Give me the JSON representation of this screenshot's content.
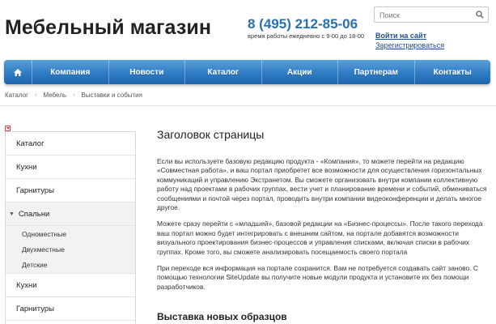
{
  "header": {
    "site_title": "Мебельный магазин",
    "phone": "8 (495) 212-85-06",
    "hours": "время работы ежедневно с 9-00 до 18-00",
    "search_placeholder": "Поиск",
    "login": "Войти на сайт",
    "register": "Зарегистрироваться"
  },
  "nav": {
    "home_icon": "home-icon",
    "items": [
      "Компания",
      "Новости",
      "Каталог",
      "Акции",
      "Партнерам",
      "Контакты"
    ]
  },
  "breadcrumb": [
    "Каталог",
    "Мебель",
    "Выставки и события"
  ],
  "sidebar": {
    "items": [
      {
        "label": "Каталог"
      },
      {
        "label": "Кухни"
      },
      {
        "label": "Гарнитуры"
      },
      {
        "label": "Спальни",
        "expanded": true,
        "children": [
          "Одноместные",
          "Двухместные",
          "Детские"
        ]
      },
      {
        "label": "Кухни"
      },
      {
        "label": "Гарнитуры"
      }
    ]
  },
  "content": {
    "title": "Заголовок страницы",
    "paragraphs": [
      "Если вы используете базовую редакцию продукта - «Компания», то можете перейти на редакцию «Совместная работа», и ваш портал приобретет все возможности для осуществления горизонтальных коммуникаций и управлению Экстранетом. Вы сможете организовать внутри компании коллективную работу над проектами в рабочих группах, вести учет и планирование времени и событий, обмениваться сообщениями и почтой через портал, проводить внутри компании видеоконференции и делать многое другое.",
      "Можете сразу перейти с «младшей», базовой редакции на «Бизнес-процессы». После такого перехода ваш портал можно будет интегрировать с внешним сайтом, на портале добавятся возможности визуального проектирования бизнес-процессов и управления списками, включая списки в рабочих группах. Кроме того, вы сможете анализировать посещаемость своего портала",
      "При переходе вся информация на портале сохранится. Вам не потребуется создавать сайт заново. С помощью технологии SiteUpdate вы получите новые модули продукта и установите их без помощи разработчиков."
    ],
    "section_title": "Выставка новых образцов"
  },
  "colors": {
    "accent": "#2a6fb0",
    "nav_gradient_top": "#5aa0d8",
    "nav_gradient_bottom": "#1f65ad"
  }
}
